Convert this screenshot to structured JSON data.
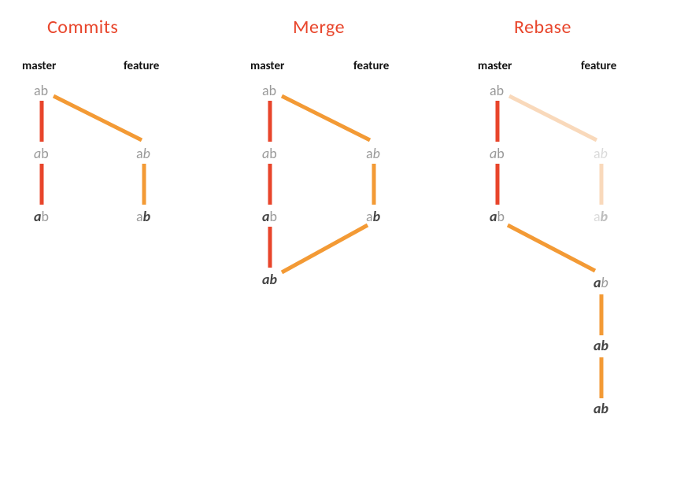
{
  "colors": {
    "title": "#e8452b",
    "red": "#e8452b",
    "orange": "#f39a35",
    "fadedOrange": "#f9d9bb",
    "gray": "#9a9a9a",
    "black": "#111111"
  },
  "panels": {
    "commits": {
      "title": "Commits",
      "branches": {
        "left": "master",
        "right": "feature"
      }
    },
    "merge": {
      "title": "Merge",
      "branches": {
        "left": "master",
        "right": "feature"
      }
    },
    "rebase": {
      "title": "Rebase",
      "branches": {
        "left": "master",
        "right": "feature"
      }
    }
  },
  "commitLabels": {
    "a": "a",
    "b": "b"
  }
}
